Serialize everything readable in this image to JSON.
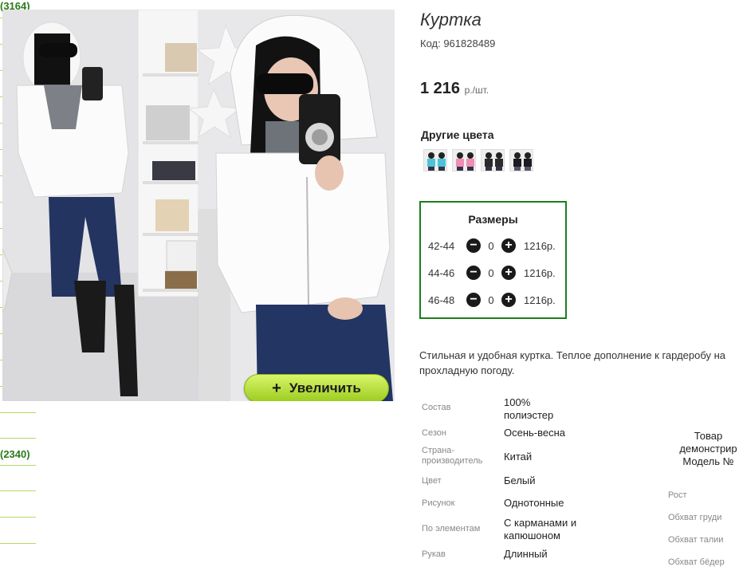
{
  "sidebar": {
    "count_top": "(3164)",
    "count_mid": "(2340)"
  },
  "gallery": {
    "zoom_icon": "+",
    "zoom_label": "Увеличить"
  },
  "product": {
    "title": "Куртка",
    "code": "Код: 961828489",
    "price": "1 216",
    "price_unit": "р./шт.",
    "other_colors_title": "Другие цвета",
    "color_swatches": [
      "blue",
      "pink",
      "black",
      "dark"
    ],
    "description": "Стильная и удобная куртка. Теплое дополнение к гардеробу на прохладную погоду."
  },
  "sizes": {
    "title": "Размеры",
    "rows": [
      {
        "size": "42-44",
        "qty": "0",
        "price": "1216р."
      },
      {
        "size": "44-46",
        "qty": "0",
        "price": "1216р."
      },
      {
        "size": "46-48",
        "qty": "0",
        "price": "1216р."
      }
    ]
  },
  "properties": [
    {
      "key": "Состав",
      "value": "100% полиэстер"
    },
    {
      "key": "Сезон",
      "value": "Осень-весна"
    },
    {
      "key": "Страна-производитель",
      "value": "Китай"
    },
    {
      "key": "Цвет",
      "value": "Белый"
    },
    {
      "key": "Рисунок",
      "value": "Однотонные"
    },
    {
      "key": "По элементам",
      "value": "С карманами и капюшоном"
    },
    {
      "key": "Рукав",
      "value": "Длинный"
    }
  ],
  "model_info": {
    "line1": "Товар",
    "line2": "демонстрир",
    "line3": "Модель №",
    "measurements": [
      "Рост",
      "Обхват груди",
      "Обхват талии",
      "Обхват бёдер"
    ]
  },
  "colors": {
    "accent_green": "#1e7d1e",
    "button_green": "#9ccc1f",
    "sidebar_green": "#2a7a1a"
  }
}
